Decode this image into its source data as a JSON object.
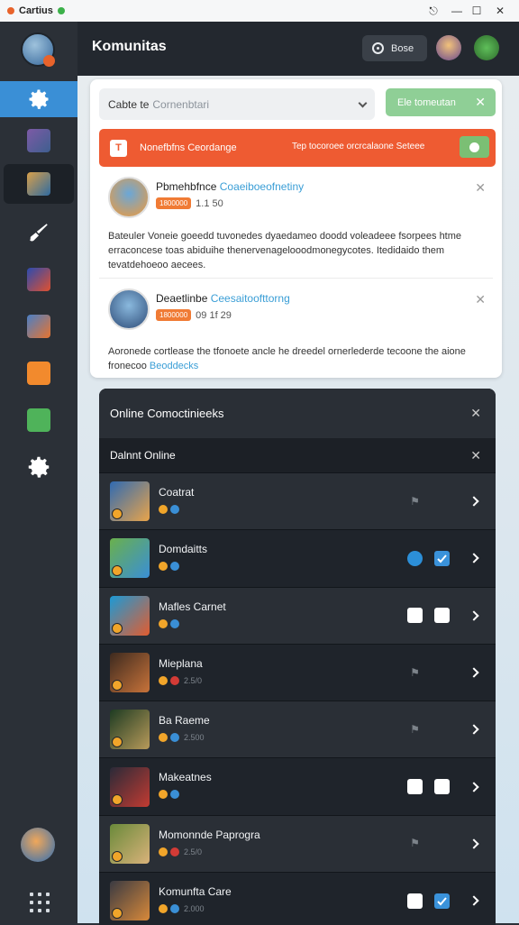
{
  "window": {
    "app_name": "Cartius",
    "controls": {
      "back": "⎋",
      "minimize": "—",
      "maximize": "☐",
      "close": "✕"
    }
  },
  "header": {
    "title": "Komunitas",
    "button_label": "Bose"
  },
  "sidebar": {
    "items": [
      "settings",
      "game-1",
      "game-2",
      "brush",
      "game-3",
      "game-4",
      "game-5",
      "game-6",
      "settings-2"
    ]
  },
  "search": {
    "label": "Cabte te",
    "placeholder": "Cornenbtari"
  },
  "green_button": {
    "label": "Ele tomeutan"
  },
  "banner": {
    "title": "Nonefbfns Ceordange",
    "text": "Tep tocoroee orcrcalaone  Seteee"
  },
  "posts": [
    {
      "name": "Pbmehbfnce",
      "name_link": "Coaeiboeofnetiny",
      "tag": "1800000",
      "time": "1.1 50",
      "body": "Bateuler Voneie goeedd tuvonedes dyaedameo doodd voleadeee fsorpees htme erraconcese toas abiduihe thenervenagelooodmonegycotes. Itedidaido them tevatdehoeoo aecees."
    },
    {
      "name": "Deaetlinbe",
      "name_link": "Ceesaitoofttorng",
      "tag": "1800000",
      "time": "09 1f 29",
      "body": "Aoronede cortlease the tfonoete ancle he dreedel ornerlederde  tecoone the aione fronecoo",
      "body_link": "Beoddecks"
    }
  ],
  "online_panel": {
    "title": "Online Comoctinieeks",
    "subtitle": "Dalnnt Online"
  },
  "online_list": [
    {
      "name": "Coatrat",
      "meta": "",
      "icons": [
        "fade"
      ]
    },
    {
      "name": "Domdaitts",
      "meta": "",
      "icons": [
        "blue-badge",
        "check"
      ]
    },
    {
      "name": "Mafles Carnet",
      "meta": "",
      "icons": [
        "white",
        "white"
      ]
    },
    {
      "name": "Mieplana",
      "meta": "2.5/0",
      "icons": [
        "fade"
      ]
    },
    {
      "name": "Ba Raeme",
      "meta": "2.500",
      "icons": [
        "fade"
      ]
    },
    {
      "name": "Makeatnes",
      "meta": "",
      "icons": [
        "white",
        "white"
      ]
    },
    {
      "name": "Momonnde Paprogra",
      "meta": "2.5/0",
      "icons": [
        "fade"
      ]
    },
    {
      "name": "Komunfta Care",
      "meta": "2.000",
      "icons": [
        "white",
        "check"
      ]
    }
  ],
  "colors": {
    "accent": "#3a8fd6",
    "banner": "#ee5b32",
    "green": "#8fcf96",
    "panel": "#1f242b"
  }
}
